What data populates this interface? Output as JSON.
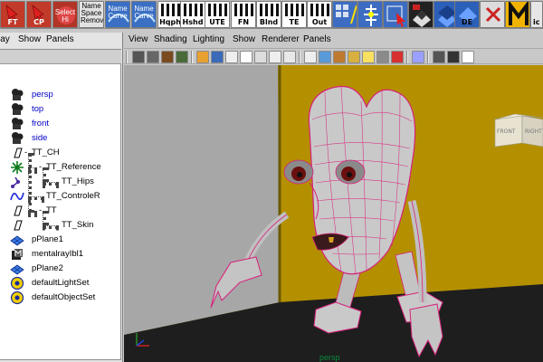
{
  "shelf": {
    "buttons": [
      {
        "label": "FT",
        "icon": "red-arrow-icon"
      },
      {
        "label": "CP",
        "icon": "red-arrow-icon"
      },
      {
        "label": "Select Hi",
        "icon": "select-hierarchy-icon"
      },
      {
        "label": "Name Space Remove",
        "icon": "namespace-icon"
      },
      {
        "label": "Name Curve",
        "icon": "name-curve-icon"
      },
      {
        "label": "Name Curve",
        "icon": "name-curve-icon"
      },
      {
        "label": "Hqph",
        "icon": "piano-keys-icon"
      },
      {
        "label": "Hshd",
        "icon": "piano-keys-icon"
      },
      {
        "label": "UTE",
        "icon": "piano-keys-icon"
      },
      {
        "label": "FN",
        "icon": "piano-keys-icon"
      },
      {
        "label": "Blnd",
        "icon": "piano-keys-icon"
      },
      {
        "label": "TE",
        "icon": "piano-keys-icon"
      },
      {
        "label": "Out",
        "icon": "piano-keys-icon"
      },
      {
        "label": "",
        "icon": "paint-weights-icon"
      },
      {
        "label": "",
        "icon": "joint-chain-icon"
      },
      {
        "label": "",
        "icon": "select-arrow-icon"
      },
      {
        "label": "",
        "icon": "checker-icon"
      },
      {
        "label": "",
        "icon": "blue-tiles-icon"
      },
      {
        "label": "DE",
        "icon": "blue-tiles-icon"
      },
      {
        "label": "",
        "icon": "delete-icon"
      },
      {
        "label": "",
        "icon": "mental-ray-icon"
      },
      {
        "label": "ic",
        "icon": "partial-icon"
      }
    ]
  },
  "outliner": {
    "menu": [
      "lay",
      "Show",
      "Panels"
    ],
    "items": [
      {
        "label": "persp",
        "icon": "camera-icon",
        "indent": 0,
        "blue": true
      },
      {
        "label": "top",
        "icon": "camera-icon",
        "indent": 0,
        "blue": true
      },
      {
        "label": "front",
        "icon": "camera-icon",
        "indent": 0,
        "blue": true
      },
      {
        "label": "side",
        "icon": "camera-icon",
        "indent": 0,
        "blue": true
      },
      {
        "label": "TT_CH",
        "icon": "transform-icon",
        "indent": 0,
        "blue": false
      },
      {
        "label": "TT_Reference",
        "icon": "locator-icon",
        "indent": 1,
        "blue": false
      },
      {
        "label": "TT_Hips",
        "icon": "joint-icon",
        "indent": 2,
        "blue": false
      },
      {
        "label": "TT_ControleR",
        "icon": "curve-icon",
        "indent": 1,
        "blue": false
      },
      {
        "label": "TT",
        "icon": "transform-icon",
        "indent": 1,
        "blue": false
      },
      {
        "label": "TT_Skin",
        "icon": "transform-icon",
        "indent": 2,
        "blue": false
      },
      {
        "label": "pPlane1",
        "icon": "plane-icon",
        "indent": 0,
        "blue": false
      },
      {
        "label": "mentalrayIbl1",
        "icon": "mentalray-node-icon",
        "indent": 0,
        "blue": false
      },
      {
        "label": "pPlane2",
        "icon": "plane-icon",
        "indent": 0,
        "blue": false
      },
      {
        "label": "defaultLightSet",
        "icon": "set-icon",
        "indent": 0,
        "blue": false
      },
      {
        "label": "defaultObjectSet",
        "icon": "set-icon",
        "indent": 0,
        "blue": false
      }
    ]
  },
  "viewport": {
    "menu": [
      "View",
      "Shading",
      "Lighting",
      "Show",
      "Renderer",
      "Panels"
    ],
    "view_cube": {
      "front": "FRONT",
      "right": "RIGHT"
    },
    "camera_label": "persp",
    "colors": {
      "background_wall": "#b49000",
      "left_wall": "#a7a7a7",
      "floor": "#1e1e1e",
      "wireframe": "#d8207a",
      "character": "#c9c9c9"
    }
  }
}
